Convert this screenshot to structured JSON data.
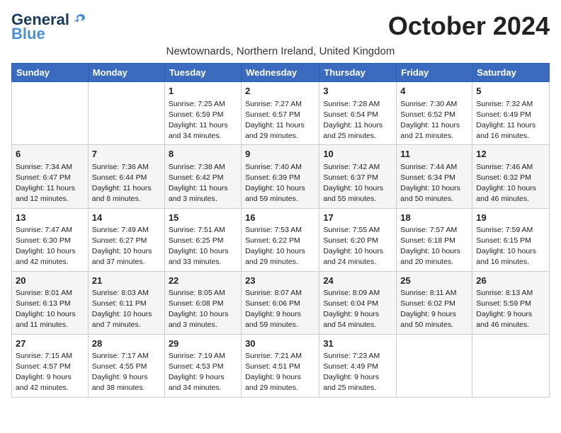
{
  "logo": {
    "line1": "General",
    "line2": "Blue"
  },
  "title": "October 2024",
  "subtitle": "Newtownards, Northern Ireland, United Kingdom",
  "days_of_week": [
    "Sunday",
    "Monday",
    "Tuesday",
    "Wednesday",
    "Thursday",
    "Friday",
    "Saturday"
  ],
  "weeks": [
    [
      {
        "day": "",
        "info": ""
      },
      {
        "day": "",
        "info": ""
      },
      {
        "day": "1",
        "info": "Sunrise: 7:25 AM\nSunset: 6:59 PM\nDaylight: 11 hours\nand 34 minutes."
      },
      {
        "day": "2",
        "info": "Sunrise: 7:27 AM\nSunset: 6:57 PM\nDaylight: 11 hours\nand 29 minutes."
      },
      {
        "day": "3",
        "info": "Sunrise: 7:28 AM\nSunset: 6:54 PM\nDaylight: 11 hours\nand 25 minutes."
      },
      {
        "day": "4",
        "info": "Sunrise: 7:30 AM\nSunset: 6:52 PM\nDaylight: 11 hours\nand 21 minutes."
      },
      {
        "day": "5",
        "info": "Sunrise: 7:32 AM\nSunset: 6:49 PM\nDaylight: 11 hours\nand 16 minutes."
      }
    ],
    [
      {
        "day": "6",
        "info": "Sunrise: 7:34 AM\nSunset: 6:47 PM\nDaylight: 11 hours\nand 12 minutes."
      },
      {
        "day": "7",
        "info": "Sunrise: 7:36 AM\nSunset: 6:44 PM\nDaylight: 11 hours\nand 8 minutes."
      },
      {
        "day": "8",
        "info": "Sunrise: 7:38 AM\nSunset: 6:42 PM\nDaylight: 11 hours\nand 3 minutes."
      },
      {
        "day": "9",
        "info": "Sunrise: 7:40 AM\nSunset: 6:39 PM\nDaylight: 10 hours\nand 59 minutes."
      },
      {
        "day": "10",
        "info": "Sunrise: 7:42 AM\nSunset: 6:37 PM\nDaylight: 10 hours\nand 55 minutes."
      },
      {
        "day": "11",
        "info": "Sunrise: 7:44 AM\nSunset: 6:34 PM\nDaylight: 10 hours\nand 50 minutes."
      },
      {
        "day": "12",
        "info": "Sunrise: 7:46 AM\nSunset: 6:32 PM\nDaylight: 10 hours\nand 46 minutes."
      }
    ],
    [
      {
        "day": "13",
        "info": "Sunrise: 7:47 AM\nSunset: 6:30 PM\nDaylight: 10 hours\nand 42 minutes."
      },
      {
        "day": "14",
        "info": "Sunrise: 7:49 AM\nSunset: 6:27 PM\nDaylight: 10 hours\nand 37 minutes."
      },
      {
        "day": "15",
        "info": "Sunrise: 7:51 AM\nSunset: 6:25 PM\nDaylight: 10 hours\nand 33 minutes."
      },
      {
        "day": "16",
        "info": "Sunrise: 7:53 AM\nSunset: 6:22 PM\nDaylight: 10 hours\nand 29 minutes."
      },
      {
        "day": "17",
        "info": "Sunrise: 7:55 AM\nSunset: 6:20 PM\nDaylight: 10 hours\nand 24 minutes."
      },
      {
        "day": "18",
        "info": "Sunrise: 7:57 AM\nSunset: 6:18 PM\nDaylight: 10 hours\nand 20 minutes."
      },
      {
        "day": "19",
        "info": "Sunrise: 7:59 AM\nSunset: 6:15 PM\nDaylight: 10 hours\nand 16 minutes."
      }
    ],
    [
      {
        "day": "20",
        "info": "Sunrise: 8:01 AM\nSunset: 6:13 PM\nDaylight: 10 hours\nand 11 minutes."
      },
      {
        "day": "21",
        "info": "Sunrise: 8:03 AM\nSunset: 6:11 PM\nDaylight: 10 hours\nand 7 minutes."
      },
      {
        "day": "22",
        "info": "Sunrise: 8:05 AM\nSunset: 6:08 PM\nDaylight: 10 hours\nand 3 minutes."
      },
      {
        "day": "23",
        "info": "Sunrise: 8:07 AM\nSunset: 6:06 PM\nDaylight: 9 hours\nand 59 minutes."
      },
      {
        "day": "24",
        "info": "Sunrise: 8:09 AM\nSunset: 6:04 PM\nDaylight: 9 hours\nand 54 minutes."
      },
      {
        "day": "25",
        "info": "Sunrise: 8:11 AM\nSunset: 6:02 PM\nDaylight: 9 hours\nand 50 minutes."
      },
      {
        "day": "26",
        "info": "Sunrise: 8:13 AM\nSunset: 5:59 PM\nDaylight: 9 hours\nand 46 minutes."
      }
    ],
    [
      {
        "day": "27",
        "info": "Sunrise: 7:15 AM\nSunset: 4:57 PM\nDaylight: 9 hours\nand 42 minutes."
      },
      {
        "day": "28",
        "info": "Sunrise: 7:17 AM\nSunset: 4:55 PM\nDaylight: 9 hours\nand 38 minutes."
      },
      {
        "day": "29",
        "info": "Sunrise: 7:19 AM\nSunset: 4:53 PM\nDaylight: 9 hours\nand 34 minutes."
      },
      {
        "day": "30",
        "info": "Sunrise: 7:21 AM\nSunset: 4:51 PM\nDaylight: 9 hours\nand 29 minutes."
      },
      {
        "day": "31",
        "info": "Sunrise: 7:23 AM\nSunset: 4:49 PM\nDaylight: 9 hours\nand 25 minutes."
      },
      {
        "day": "",
        "info": ""
      },
      {
        "day": "",
        "info": ""
      }
    ]
  ]
}
